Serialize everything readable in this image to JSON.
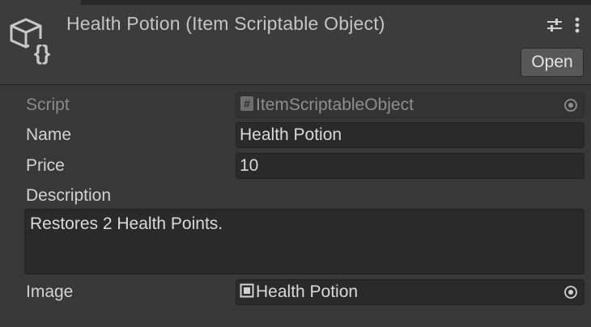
{
  "header": {
    "title": "Health Potion (Item Scriptable Object)",
    "open_label": "Open",
    "icons": [
      "scriptable-object-icon",
      "settings-sliders-icon",
      "more-vertical-icon"
    ]
  },
  "fields": {
    "script": {
      "label": "Script",
      "value": "ItemScriptableObject",
      "icon": "script-hash-icon",
      "disabled": true
    },
    "name": {
      "label": "Name",
      "value": "Health Potion"
    },
    "price": {
      "label": "Price",
      "value": "10"
    },
    "description": {
      "label": "Description",
      "value": "Restores 2 Health Points."
    },
    "image": {
      "label": "Image",
      "value": "Health Potion",
      "icon": "sprite-icon"
    }
  },
  "colors": {
    "background": "#383838",
    "header": "#3c3c3c",
    "field": "#2a2a2a",
    "button": "#585858"
  }
}
